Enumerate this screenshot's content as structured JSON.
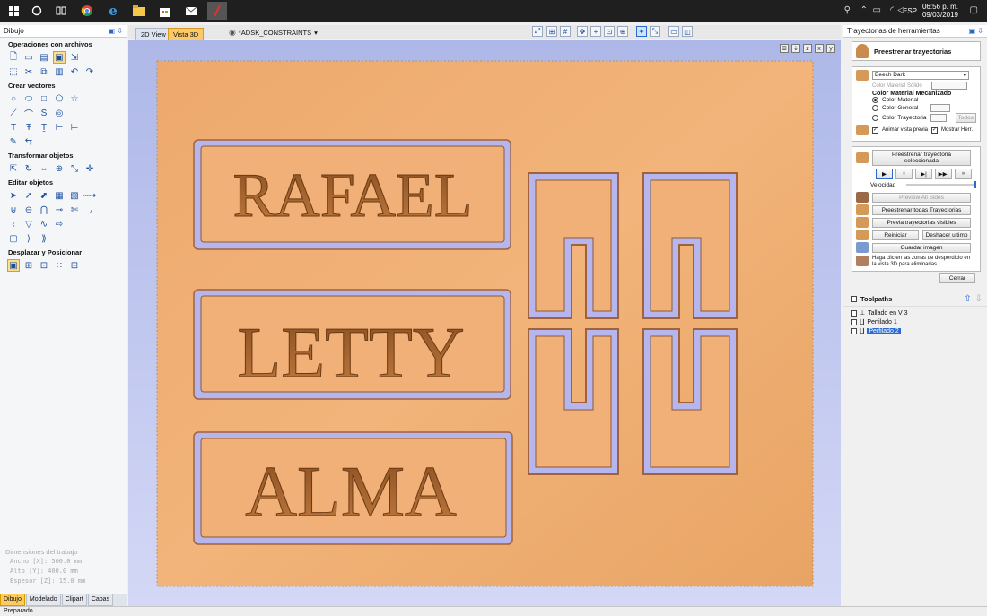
{
  "taskbar": {
    "clock_time": "06:56 p. m.",
    "clock_date": "09/03/2019",
    "language": "ESP"
  },
  "left_panel": {
    "title": "Dibujo",
    "sections": [
      {
        "name": "Operaciones con archivos",
        "rows": [
          [
            "new-file-icon",
            "open-folder-icon",
            "save-icon",
            "open-project-icon",
            "import-icon"
          ],
          [
            "select-frame-icon",
            "cut-icon",
            "copy-icon",
            "paste-icon",
            "undo-icon",
            "redo-icon"
          ]
        ]
      },
      {
        "name": "Crear vectores",
        "rows": [
          [
            "circle-icon",
            "ellipse-icon",
            "rectangle-icon",
            "polygon-icon",
            "star-icon"
          ],
          [
            "line-icon",
            "arc-icon",
            "spiral-icon",
            "spiral-round-icon"
          ],
          [
            "text-icon",
            "text-frame-icon",
            "text-arc-icon",
            "measure-icon",
            "dimension-icon"
          ],
          [
            "draw-icon",
            "move-icon"
          ]
        ]
      },
      {
        "name": "Transformar objetos",
        "rows": [
          [
            "move-transform-icon",
            "rotate-icon",
            "mirror-icon",
            "align-icon",
            "scale-icon",
            "center-icon"
          ]
        ]
      },
      {
        "name": "Editar objetos",
        "rows": [
          [
            "select-icon",
            "node-edit-icon",
            "transform-icon",
            "group-icon",
            "ungroup-icon",
            "trim-icon"
          ],
          [
            "weld-icon",
            "subtract-icon",
            "intersect-icon",
            "join-icon",
            "scissors-icon",
            "fillet-icon"
          ],
          [
            "offset-icon",
            "distort-icon",
            "curve-icon",
            "arrow-icon"
          ],
          [
            "rect-round-icon",
            "bracket-icon",
            "bracket-right-icon"
          ]
        ]
      },
      {
        "name": "Desplazar y Posicionar",
        "rows": [
          [
            "tile-icon",
            "grid-icon",
            "nest-icon",
            "array-icon",
            "layout-icon"
          ]
        ]
      }
    ],
    "dimensions": {
      "title": "Dimensiones del trabajo",
      "width": "Ancho   [X]: 500.0 mm",
      "height": "Alto    [Y]: 400.0 mm",
      "thickness": "Espesor [Z]: 15.0 mm"
    },
    "tabs": [
      "Dibujo",
      "Modelado",
      "Clipart",
      "Capas"
    ]
  },
  "view_tabs": {
    "tab_2d": "2D View",
    "tab_3d": "Vista 3D",
    "layer": "*ADSK_CONSTRAINTS"
  },
  "plaques": [
    "RAFAEL",
    "LETTY",
    "ALMA"
  ],
  "colors": {
    "wood": "#e9a86a",
    "wood_dark": "#b8733a",
    "outline": "#b6b5ee"
  },
  "right_panel": {
    "title": "Trayectorias de herramientas",
    "preview_title": "Preestrenar trayectorias",
    "material": "Beech Dark",
    "solid_color_label": "Color Material Sólido",
    "machining_heading": "Color Material Mecanizado",
    "radio_material": "Color Material",
    "radio_general": "Color General",
    "radio_toolpath": "Color Trayectoria",
    "all_button": "Todos",
    "animate_label": "Animar vista previa",
    "show_tool_label": "Mostrar Herr.",
    "preview_selected": "Preestrenar trayectoria seleccionada",
    "speed_label": "Velocidad",
    "preview_all_sides": "Preview All Sides",
    "preview_all": "Preestrenar todas Trayectorias",
    "preview_visible": "Previa trayectorias visibles",
    "reset": "Reiniciar",
    "undo_last": "Deshacer ultimo",
    "save_image": "Guardar imagen",
    "hint": "Haga clic en las zonas de desperdicio en la vista 3D para eliminarlas.",
    "close": "Cerrar",
    "toolpaths_header": "Toolpaths",
    "toolpaths": [
      "Tallado en V 3",
      "Perfilado 1",
      "Perfilado 2"
    ]
  },
  "status": "Preparado"
}
